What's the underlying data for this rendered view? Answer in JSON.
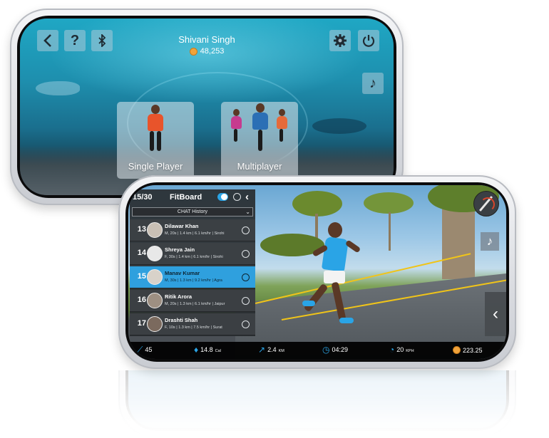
{
  "menu_screen": {
    "player_name": "Shivani Singh",
    "coins": "48,253",
    "back_icon": "chevron-left-icon",
    "help_label": "?",
    "bluetooth_icon": "bluetooth-icon",
    "settings_icon": "gear-icon",
    "power_icon": "power-icon",
    "music_icon": "music-note-icon",
    "modes": [
      {
        "label": "Single Player"
      },
      {
        "label": "Multiplayer"
      }
    ]
  },
  "ride_screen": {
    "fitboard": {
      "rank": "15/30",
      "title": "FitBoard",
      "chat_label": "CHAT History",
      "rows": [
        {
          "rank": "13",
          "name": "Dilawar Khan",
          "gender_age": "M, 20s",
          "distance": "1.4 km",
          "speed": "6.1 km/hr",
          "city": "Sirohi",
          "highlight": false
        },
        {
          "rank": "14",
          "name": "Shreya Jain",
          "gender_age": "F, 30s",
          "distance": "1.4 km",
          "speed": "6.1 km/hr",
          "city": "Sirohi",
          "highlight": false
        },
        {
          "rank": "15",
          "name": "Manav Kumar",
          "gender_age": "M, 30s",
          "distance": "1.3 km",
          "speed": "9.2 km/hr",
          "city": "Agra",
          "highlight": true
        },
        {
          "rank": "16",
          "name": "Ritik Arora",
          "gender_age": "M, 20s",
          "distance": "1.3 km",
          "speed": "6.1 km/hr",
          "city": "Jaipur",
          "highlight": false
        },
        {
          "rank": "17",
          "name": "Drashti Shah",
          "gender_age": "F, 10s",
          "distance": "1.3 km",
          "speed": "7.5 km/hr",
          "city": "Surat",
          "highlight": false
        }
      ]
    },
    "stats": {
      "incline": "45",
      "calories": "14.8",
      "calories_unit": "Cal",
      "distance": "2.4",
      "distance_unit": "KM",
      "time": "04:29",
      "speed": "20",
      "speed_unit": "KPH",
      "coins": "223.25"
    },
    "colors": {
      "accent": "#2aa4e6",
      "highlight_row": "#2fa0de",
      "coin": "#f1a33b"
    }
  }
}
